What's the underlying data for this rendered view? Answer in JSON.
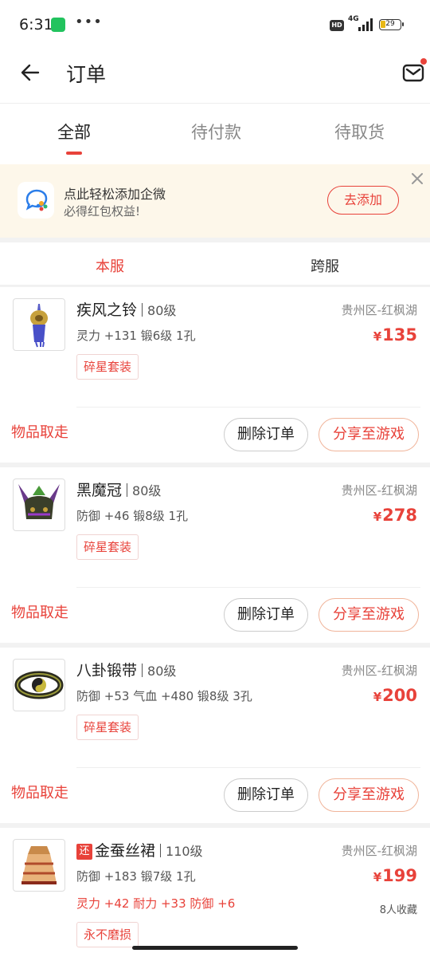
{
  "status_bar": {
    "time": "6:31",
    "dots": "•••",
    "hd": "HD",
    "network": "4G",
    "battery": "29"
  },
  "header": {
    "title": "订单"
  },
  "tabs": [
    {
      "label": "全部"
    },
    {
      "label": "待付款"
    },
    {
      "label": "待取货"
    }
  ],
  "banner": {
    "title": "点此轻松添加企微",
    "subtitle": "必得红包权益!",
    "button": "去添加"
  },
  "server_tabs": [
    {
      "label": "本服"
    },
    {
      "label": "跨服"
    }
  ],
  "orders": [
    {
      "name": "疾风之铃",
      "level": "80级",
      "attrs": "灵力 +131 锻6级 1孔",
      "tag": "碎星套装",
      "server": "贵州区-红枫湖",
      "currency": "¥",
      "price": "135",
      "status": "物品取走",
      "delete": "删除订单",
      "share": "分享至游戏"
    },
    {
      "name": "黑魔冠",
      "level": "80级",
      "attrs": "防御 +46 锻8级 1孔",
      "tag": "碎星套装",
      "server": "贵州区-红枫湖",
      "currency": "¥",
      "price": "278",
      "status": "物品取走",
      "delete": "删除订单",
      "share": "分享至游戏"
    },
    {
      "name": "八卦锻带",
      "level": "80级",
      "attrs": "防御 +53 气血 +480 锻8级 3孔",
      "tag": "碎星套装",
      "server": "贵州区-红枫湖",
      "currency": "¥",
      "price": "200",
      "status": "物品取走",
      "delete": "删除订单",
      "share": "分享至游戏"
    },
    {
      "badge": "还",
      "name": "金蚕丝裙",
      "level": "110级",
      "attrs": "防御 +183 锻7级 1孔",
      "attrs2": "灵力 +42 耐力 +33 防御 +6",
      "tag": "永不磨损",
      "server": "贵州区-红枫湖",
      "currency": "¥",
      "price": "199",
      "favorites": "8人收藏"
    }
  ],
  "colors": {
    "accent": "#e8423a",
    "banner_bg": "#fdf7ea",
    "page_bg": "#f2f2f2"
  }
}
